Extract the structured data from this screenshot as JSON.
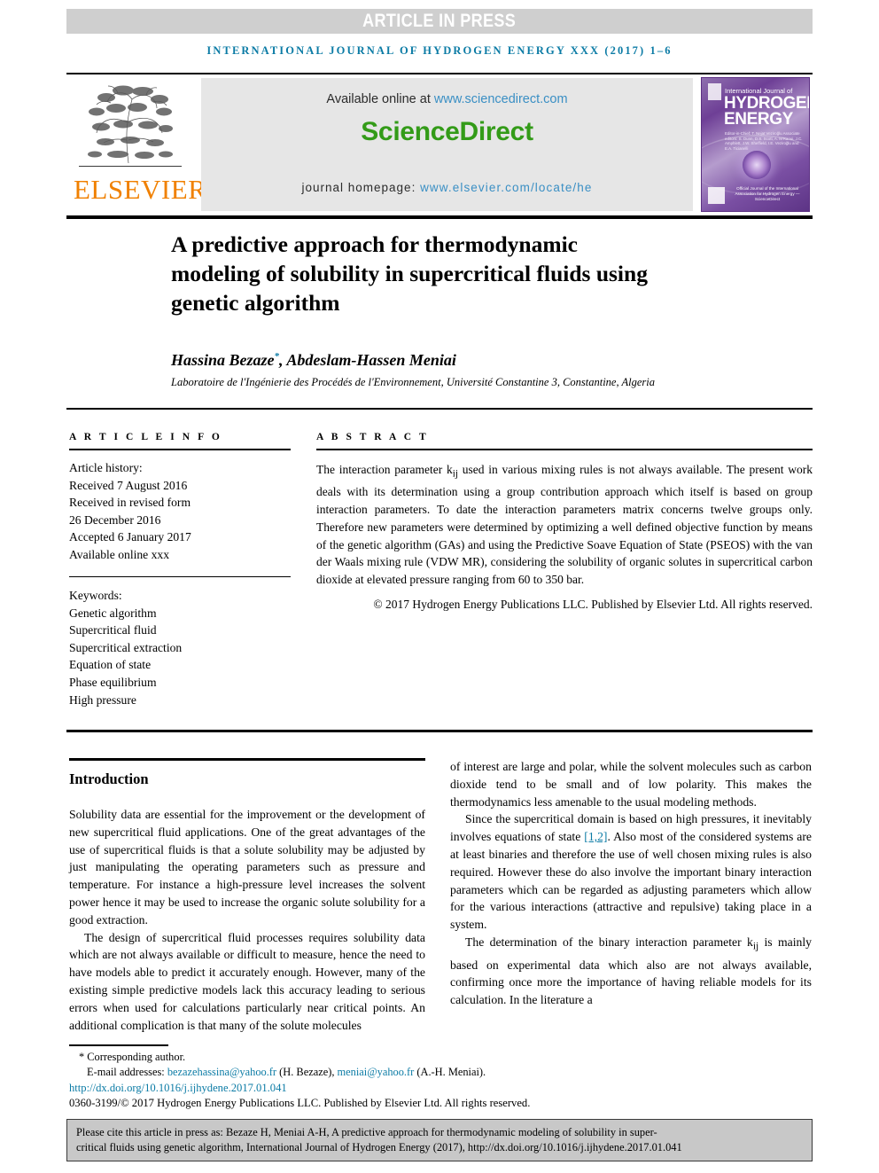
{
  "banner": {
    "text": "ARTICLE IN PRESS"
  },
  "running_head": {
    "text": "INTERNATIONAL JOURNAL OF HYDROGEN ENERGY XXX (2017) 1–6"
  },
  "masthead": {
    "publisher_logo_text": "ELSEVIER",
    "available_online_prefix": "Available online at ",
    "available_online_url": "www.sciencedirect.com",
    "sciencedirect_logo": "ScienceDirect",
    "homepage_prefix": "journal homepage: ",
    "homepage_url": "www.elsevier.com/locate/he",
    "cover": {
      "line1": "International Journal of",
      "line2": "HYDROGEN",
      "line3": "ENERGY",
      "editors": "Editor-in-Chief: T. Nejat Veziroğlu  Associate editors: S. Dunn, D.S. Scott, A. M'Raoui, J.C. Amphlett, J.W. Sheffield, I.E. Veziroğlu and E.A. Ticianelli",
      "footer": "Official Journal of the International Association for Hydrogen Energy — ScienceDirect"
    }
  },
  "article": {
    "title_line1": "A predictive approach for thermodynamic",
    "title_line2": "modeling of solubility in supercritical fluids using",
    "title_line3": "genetic algorithm",
    "authors": "Hassina Bezaze",
    "corresponding_marker": "*",
    "authors_rest": ", Abdeslam-Hassen Meniai",
    "affiliation": "Laboratoire de l'Ingénierie des Procédés de l'Environnement, Université Constantine 3, Constantine, Algeria"
  },
  "article_info": {
    "label": "A R T I C L E   I N F O",
    "history_heading": "Article history:",
    "history": [
      "Received 7 August 2016",
      "Received in revised form",
      "26 December 2016",
      "Accepted 6 January 2017",
      "Available online xxx"
    ],
    "keywords_heading": "Keywords:",
    "keywords": [
      "Genetic algorithm",
      "Supercritical fluid",
      "Supercritical extraction",
      "Equation of state",
      "Phase equilibrium",
      "High pressure"
    ]
  },
  "abstract": {
    "label": "A B S T R A C T",
    "text": "The interaction parameter kij used in various mixing rules is not always available. The present work deals with its determination using a group contribution approach which itself is based on group interaction parameters. To date the interaction parameters matrix concerns twelve groups only. Therefore new parameters were determined by optimizing a well defined objective function by means of the genetic algorithm (GAs) and using the Predictive Soave Equation of State (PSEOS) with the van der Waals mixing rule (VDW MR), considering the solubility of organic solutes in supercritical carbon dioxide at elevated pressure ranging from 60 to 350 bar.",
    "copyright": "© 2017 Hydrogen Energy Publications LLC. Published by Elsevier Ltd. All rights reserved."
  },
  "body": {
    "introduction_heading": "Introduction",
    "left_paragraph_1": "Solubility data are essential for the improvement or the development of new supercritical fluid applications. One of the great advantages of the use of supercritical fluids is that a solute solubility may be adjusted by just manipulating the operating parameters such as pressure and temperature. For instance a high-pressure level increases the solvent power hence it may be used to increase the organic solute solubility for a good extraction.",
    "left_paragraph_2": "The design of supercritical fluid processes requires solubility data which are not always available or difficult to measure, hence the need to have models able to predict it accurately enough. However, many of the existing simple predictive models lack this accuracy leading to serious errors when used for calculations particularly near critical points. An additional complication is that many of the solute molecules",
    "right_paragraph_1": "of interest are large and polar, while the solvent molecules such as carbon dioxide tend to be small and of low polarity. This makes the thermodynamics less amenable to the usual modeling methods.",
    "right_paragraph_2a": "Since the supercritical domain is based on high pressures, it inevitably involves equations of state ",
    "right_paragraph_2_ref": "[1,2]",
    "right_paragraph_2b": ". Also most of the considered systems are at least binaries and therefore the use of well chosen mixing rules is also required. However these do also involve the important binary interaction parameters which can be regarded as adjusting parameters which allow for the various interactions (attractive and repulsive) taking place in a system.",
    "right_paragraph_3": "The determination of the binary interaction parameter kij is mainly based on experimental data which also are not always available, confirming once more the importance of having reliable models for its calculation. In the literature a"
  },
  "footnote": {
    "corresponding": "* Corresponding author.",
    "email_label": "E-mail addresses: ",
    "email1": "bezazehassina@yahoo.fr",
    "email1_owner": " (H. Bezaze), ",
    "email2": "meniai@yahoo.fr",
    "email2_owner": " (A.-H. Meniai).",
    "doi": "http://dx.doi.org/10.1016/j.ijhydene.2017.01.041",
    "issn": "0360-3199/© 2017 Hydrogen Energy Publications LLC. Published by Elsevier Ltd. All rights reserved."
  },
  "citation_box": {
    "line1": "Please cite this article in press as: Bezaze H, Meniai A-H, A predictive approach for thermodynamic modeling of solubility in super-",
    "line2": "critical fluids using genetic algorithm, International Journal of Hydrogen Energy (2017), http://dx.doi.org/10.1016/j.ijhydene.2017.01.041"
  },
  "colors": {
    "journal_blue": "#0b7ba5",
    "link_blue": "#3a8fc4",
    "elsevier_orange": "#f08000",
    "sciencedirect_green": "#339b18",
    "banner_gray": "#cfcfcf",
    "cite_gray": "#c8c8c8"
  }
}
